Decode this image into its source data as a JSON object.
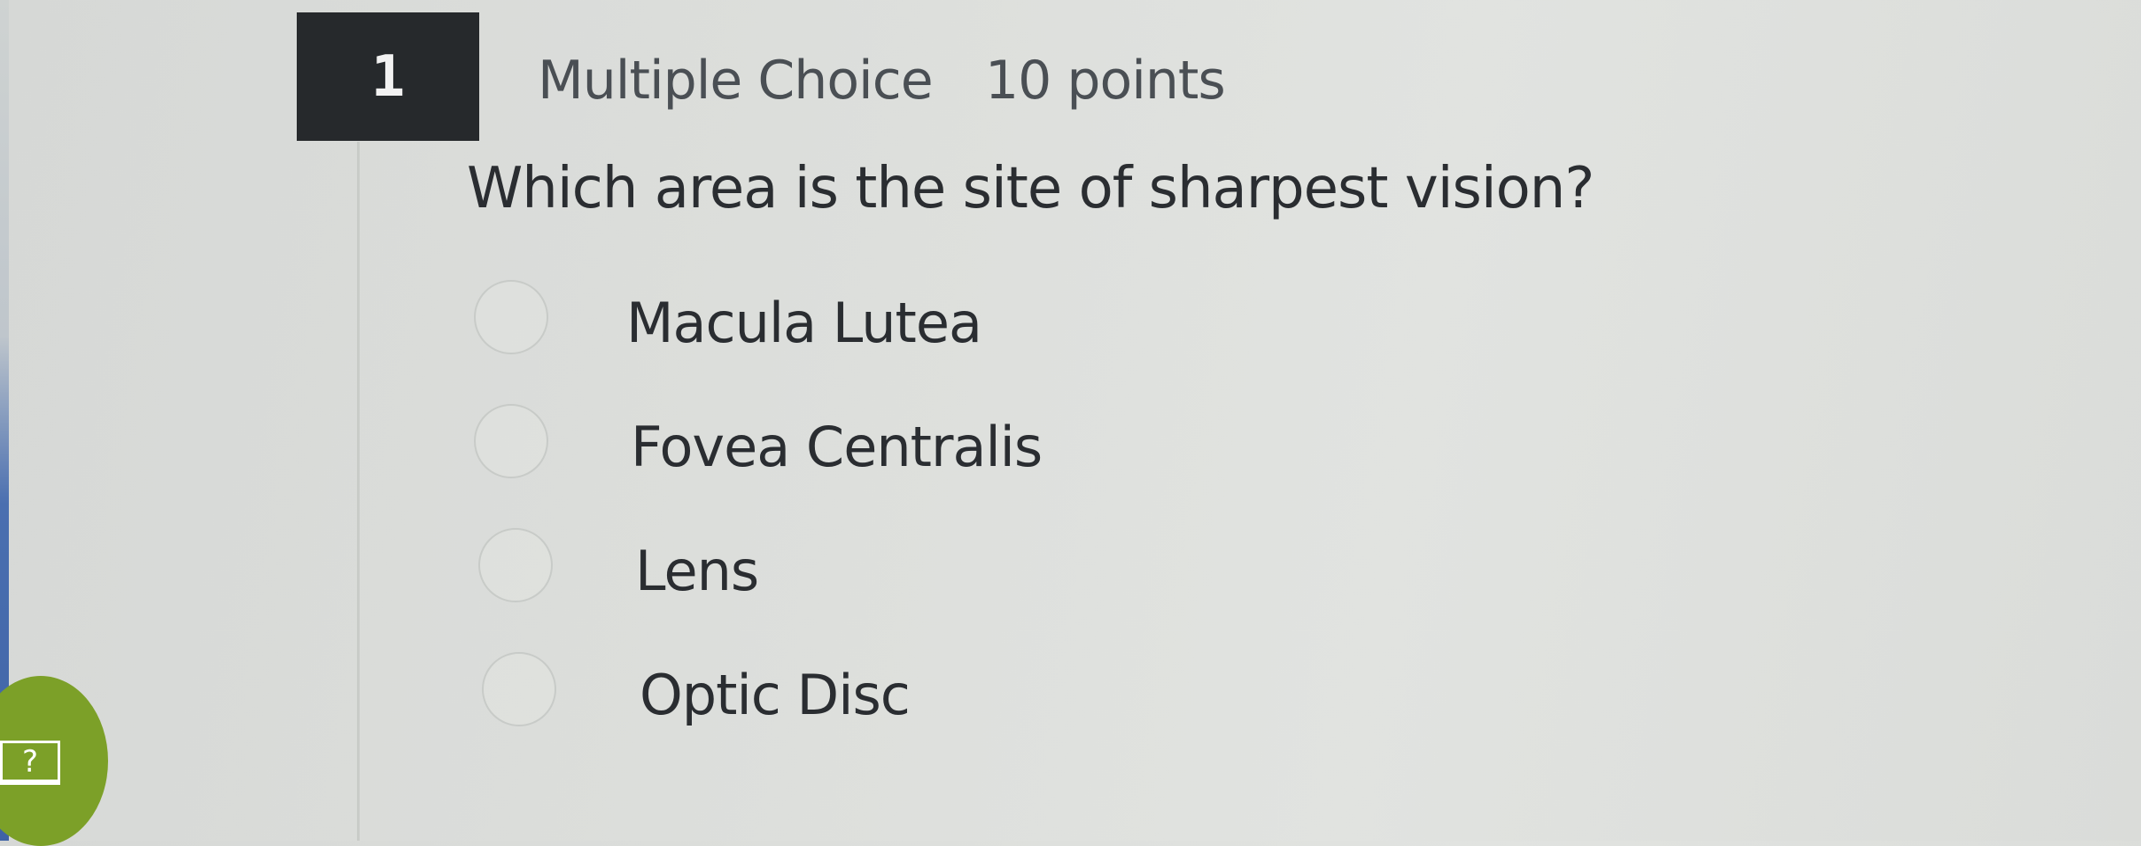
{
  "question": {
    "number": "1",
    "type": "Multiple Choice",
    "points": "10 points",
    "text": "Which area is the site of sharpest vision?",
    "options": [
      {
        "label": "Macula Lutea",
        "selected": false
      },
      {
        "label": "Fovea Centralis",
        "selected": false
      },
      {
        "label": "Lens",
        "selected": false
      },
      {
        "label": "Optic Disc",
        "selected": false
      }
    ]
  },
  "help": {
    "icon": "question-mark-icon",
    "symbol": "?"
  },
  "colors": {
    "question_number_bg": "#26292c",
    "help_button_bg": "#7ca028",
    "text": "#2a2d31"
  }
}
